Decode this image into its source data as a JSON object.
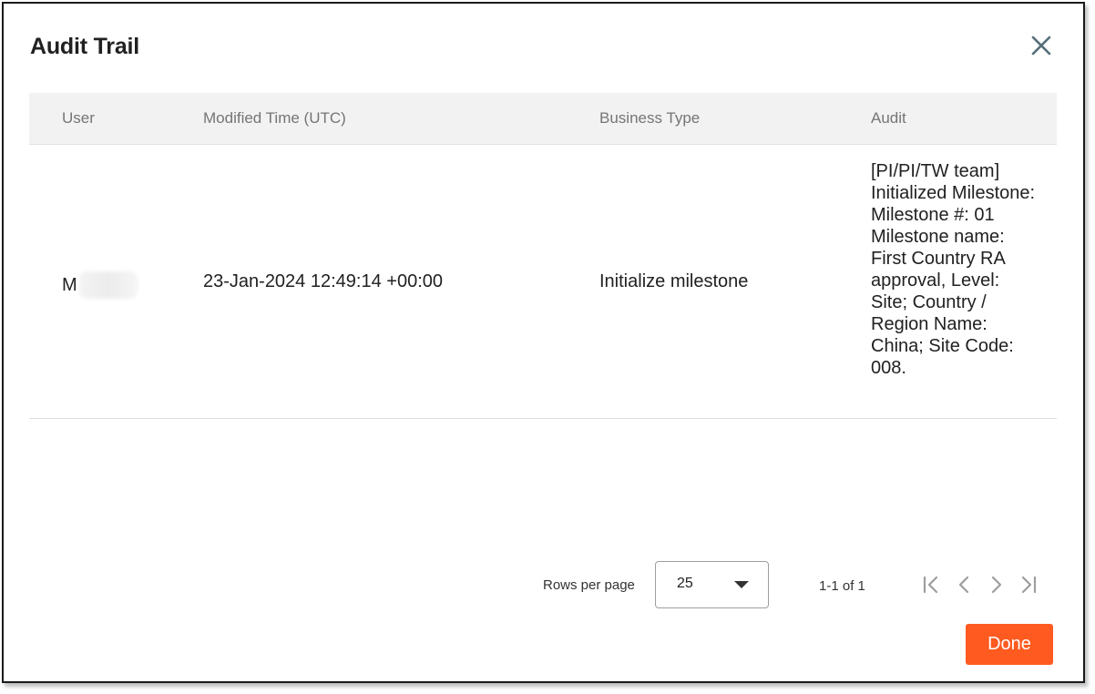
{
  "dialog": {
    "title": "Audit Trail",
    "close_icon": "close-icon"
  },
  "table": {
    "headers": {
      "user": "User",
      "modified_time": "Modified Time (UTC)",
      "business_type": "Business Type",
      "audit": "Audit"
    },
    "rows": [
      {
        "user": "M",
        "modified_time": "23-Jan-2024 12:49:14 +00:00",
        "business_type": "Initialize milestone",
        "audit": "[PI/PI/TW team] Initialized Milestone: Milestone #: 01 Milestone name: First Country RA approval, Level: Site; Country / Region Name: China; Site Code: 008."
      }
    ]
  },
  "pagination": {
    "rows_per_page_label": "Rows per page",
    "rows_per_page_value": "25",
    "range_text": "1-1 of 1",
    "icons": [
      "first-page-icon",
      "previous-page-icon",
      "next-page-icon",
      "last-page-icon"
    ]
  },
  "footer": {
    "done_label": "Done"
  },
  "colors": {
    "accent": "#ff5a1f",
    "header_bg": "#f2f2f2",
    "close_icon": "#546e7a"
  }
}
